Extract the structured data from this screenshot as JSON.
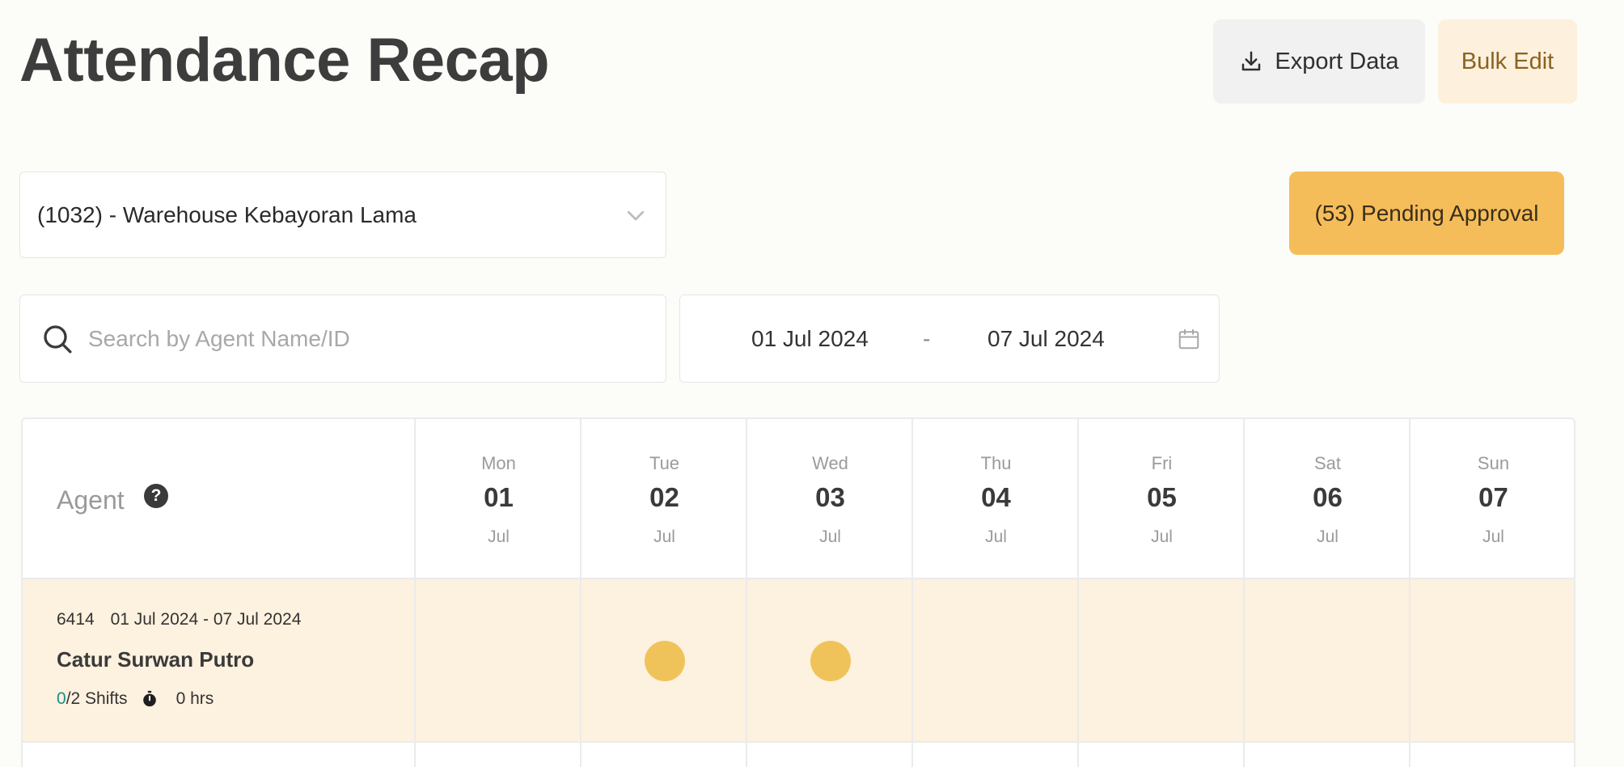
{
  "header": {
    "title": "Attendance Recap",
    "export_label": "Export Data",
    "bulk_edit_label": "Bulk Edit"
  },
  "filters": {
    "warehouse": "(1032) - Warehouse Kebayoran Lama",
    "pending_label": "(53) Pending Approval",
    "search_placeholder": "Search by Agent Name/ID",
    "date_start": "01 Jul 2024",
    "date_separator": "-",
    "date_end": "07 Jul 2024"
  },
  "table": {
    "agent_header": "Agent",
    "help_glyph": "?",
    "days": [
      {
        "dow": "Mon",
        "num": "01",
        "month": "Jul"
      },
      {
        "dow": "Tue",
        "num": "02",
        "month": "Jul"
      },
      {
        "dow": "Wed",
        "num": "03",
        "month": "Jul"
      },
      {
        "dow": "Thu",
        "num": "04",
        "month": "Jul"
      },
      {
        "dow": "Fri",
        "num": "05",
        "month": "Jul"
      },
      {
        "dow": "Sat",
        "num": "06",
        "month": "Jul"
      },
      {
        "dow": "Sun",
        "num": "07",
        "month": "Jul"
      }
    ],
    "rows": [
      {
        "agent_id": "6414",
        "period": "01 Jul 2024 - 07 Jul 2024",
        "name": "Catur Surwan Putro",
        "shifts_done": "0",
        "shifts_total": "/2 Shifts",
        "hours": "0 hrs",
        "shift_days": [
          false,
          true,
          true,
          false,
          false,
          false,
          false
        ]
      }
    ]
  },
  "colors": {
    "pending_bg": "#f5bd5a",
    "row_bg": "#fdf1df",
    "shift_dot": "#f0c35a",
    "bulk_edit_bg": "#fdf0dc"
  },
  "icons": {
    "export": "download-icon",
    "select": "chevron-down-icon",
    "search": "search-icon",
    "date": "calendar-icon",
    "help": "help-icon",
    "hours": "timer-icon"
  }
}
